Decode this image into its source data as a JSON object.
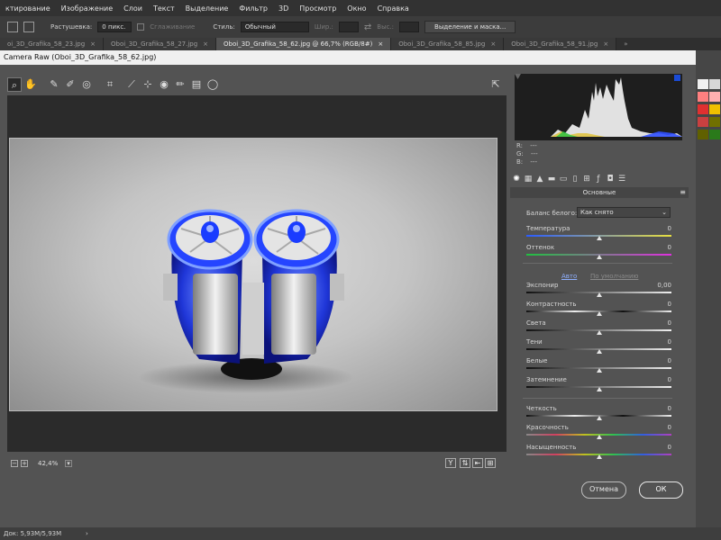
{
  "menubar": [
    "ктирование",
    "Изображение",
    "Слои",
    "Текст",
    "Выделение",
    "Фильтр",
    "3D",
    "Просмотр",
    "Окно",
    "Справка"
  ],
  "optbar": {
    "feather_label": "Растушевка:",
    "feather_value": "0 пикс.",
    "smooth_label": "Сглаживание",
    "style_label": "Стиль:",
    "style_value": "Обычный",
    "width_label": "Шир.:",
    "height_label": "Выс.:",
    "select_mask": "Выделение и маска..."
  },
  "tabs": [
    {
      "label": "oi_3D_Grafika_58_23.jpg"
    },
    {
      "label": "Oboi_3D_Grafika_58_27.jpg"
    },
    {
      "label": "Oboi_3D_Grafika_58_62.jpg @ 66,7% (RGB/8#)"
    },
    {
      "label": "Oboi_3D_Grafika_58_85.jpg"
    },
    {
      "label": "Oboi_3D_Grafika_58_91.jpg"
    }
  ],
  "dialog": {
    "title": "Camera Raw (Oboi_3D_Grafika_58_62.jpg)",
    "zoom": "42,4%",
    "cancel": "Отмена",
    "ok": "ОК"
  },
  "readout": {
    "r": "R:",
    "g": "G:",
    "b": "B:",
    "r_val": "---",
    "g_val": "---",
    "b_val": "---"
  },
  "panel": {
    "title": "Основные",
    "wb_label": "Баланс белого:",
    "wb_value": "Как снято",
    "auto": "Авто",
    "default": "По умолчанию",
    "sliders": [
      {
        "name": "temperature",
        "label": "Температура",
        "value": "0",
        "pos": 0.5
      },
      {
        "name": "tint",
        "label": "Оттенок",
        "value": "0",
        "pos": 0.5
      },
      {
        "name": "exposure",
        "label": "Экспонир",
        "value": "0,00",
        "pos": 0.5
      },
      {
        "name": "contrast",
        "label": "Контрастность",
        "value": "0",
        "pos": 0.5
      },
      {
        "name": "highlights",
        "label": "Света",
        "value": "0",
        "pos": 0.5
      },
      {
        "name": "shadows",
        "label": "Тени",
        "value": "0",
        "pos": 0.5
      },
      {
        "name": "whites",
        "label": "Белые",
        "value": "0",
        "pos": 0.5
      },
      {
        "name": "blacks",
        "label": "Затемнение",
        "value": "0",
        "pos": 0.5
      },
      {
        "name": "clarity",
        "label": "Четкость",
        "value": "0",
        "pos": 0.5
      },
      {
        "name": "vibrance",
        "label": "Красочность",
        "value": "0",
        "pos": 0.5
      },
      {
        "name": "saturation",
        "label": "Насыщенность",
        "value": "0",
        "pos": 0.5
      }
    ]
  },
  "ps_status": "Док: 5,93M/5,93M",
  "colors": {
    "accent": "#1a4bd6",
    "panel": "#535353",
    "dark": "#2b2b2b"
  }
}
